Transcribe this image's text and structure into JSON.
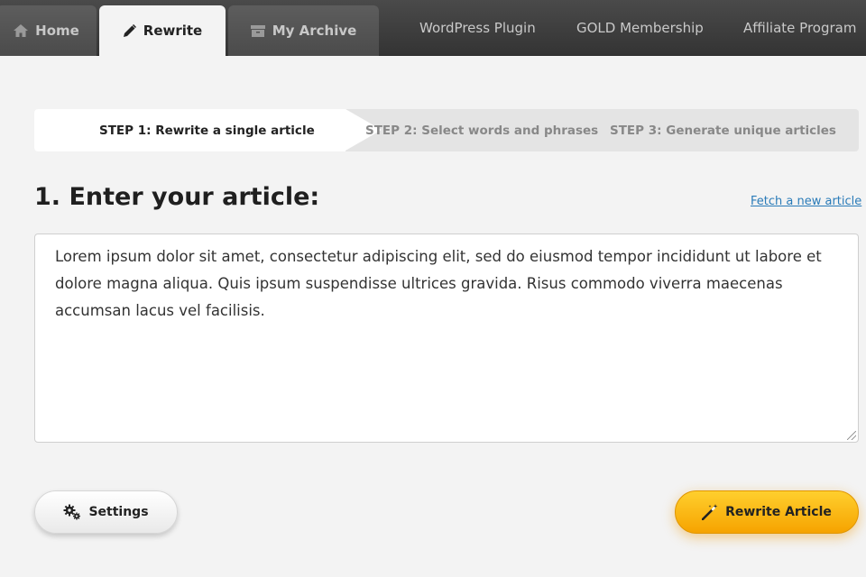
{
  "nav": {
    "tabs": [
      {
        "label": "Home",
        "icon": "home-icon"
      },
      {
        "label": "Rewrite",
        "icon": "pencil-icon",
        "active": true
      },
      {
        "label": "My Archive",
        "icon": "archive-icon"
      }
    ],
    "links": [
      "WordPress Plugin",
      "GOLD Membership",
      "Affiliate Program"
    ]
  },
  "steps": [
    {
      "label": "STEP 1: Rewrite a single article",
      "active": true
    },
    {
      "label": "STEP 2: Select words and phrases",
      "active": false
    },
    {
      "label": "STEP 3: Generate unique articles",
      "active": false
    }
  ],
  "main": {
    "heading": "1. Enter your article:",
    "fetch_link": "Fetch a new article",
    "article_text": "Lorem ipsum dolor sit amet, consectetur adipiscing elit, sed do eiusmod tempor incididunt ut labore et dolore magna aliqua. Quis ipsum suspendisse ultrices gravida. Risus commodo viverra maecenas accumsan lacus vel facilisis."
  },
  "buttons": {
    "settings": {
      "label": "Settings",
      "icon": "gears-icon"
    },
    "rewrite": {
      "label": "Rewrite Article",
      "icon": "magic-wand-icon"
    }
  },
  "colors": {
    "accent": "#f8b400",
    "nav_bg": "#3c3c3c",
    "link": "#2a7bb8"
  }
}
